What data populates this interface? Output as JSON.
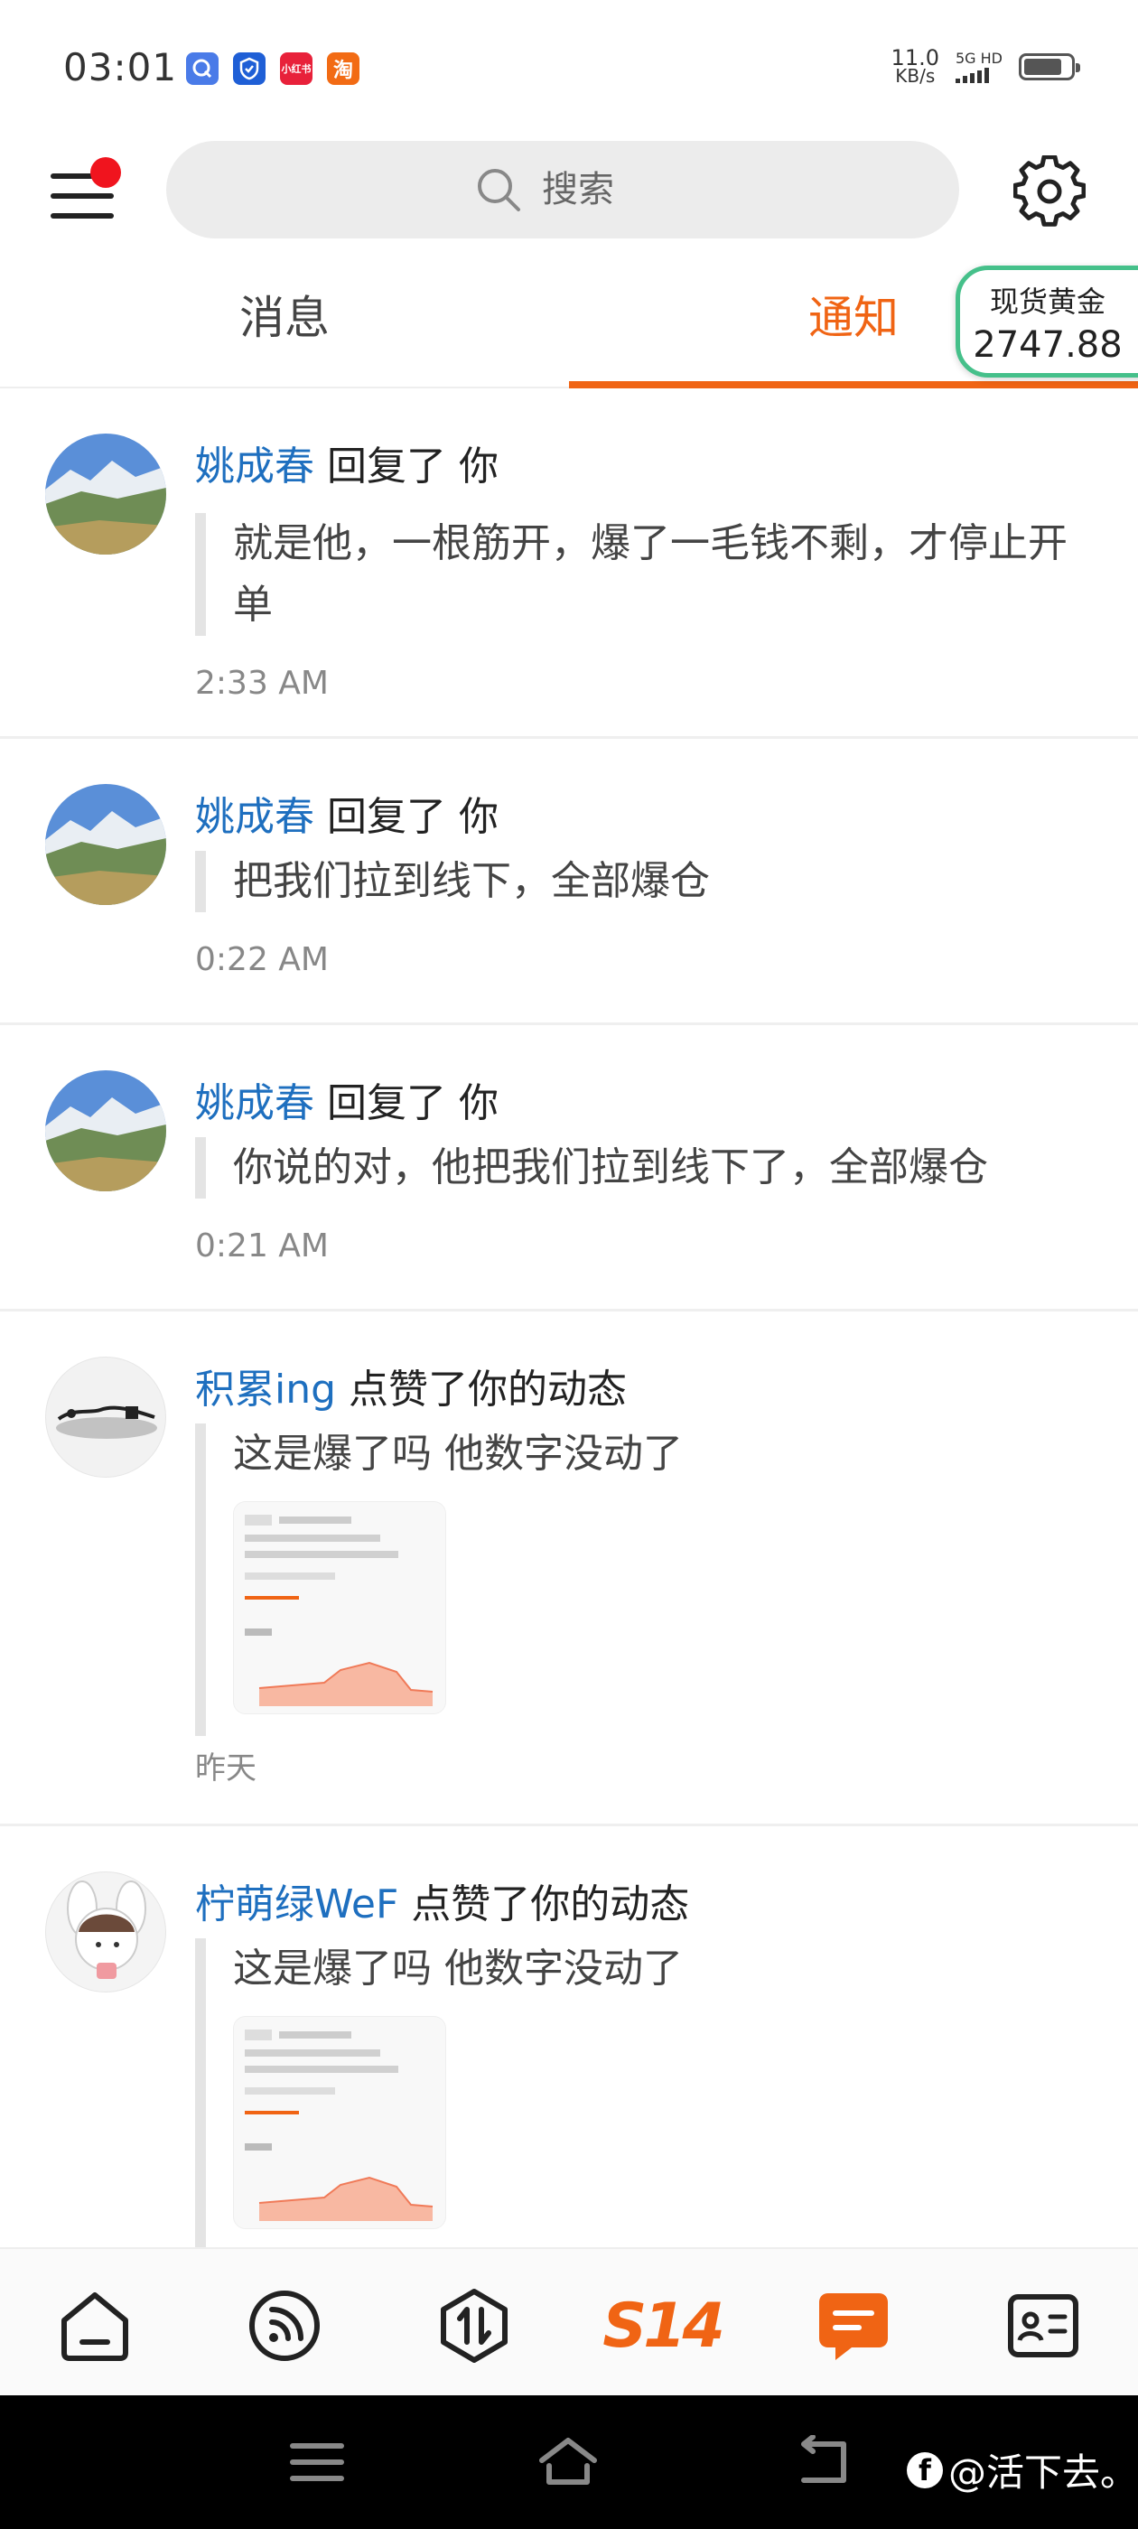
{
  "status_bar": {
    "time": "03:01",
    "apps": [
      {
        "icon": "app-icon-blue-q",
        "color": "#4a7be8",
        "label": "Q"
      },
      {
        "icon": "app-icon-shield",
        "color": "#1f5fd6",
        "label": "盾"
      },
      {
        "icon": "app-icon-xiaohongshu",
        "color": "#e8213a",
        "label": "小红书"
      },
      {
        "icon": "app-icon-taobao",
        "color": "#f26b14",
        "label": "淘"
      }
    ],
    "net_speed_value": "11.0",
    "net_speed_unit": "KB/s",
    "network": "5G HD",
    "battery_level": 0.82
  },
  "top_bar": {
    "search_placeholder": "搜索"
  },
  "tabs": {
    "messages": "消息",
    "notice": "通知",
    "active": "notice"
  },
  "gold_badge": {
    "label": "现货黄金",
    "value": "2747.88"
  },
  "notifications": [
    {
      "user": "姚成春",
      "action": "回复了 你",
      "content": "就是他，一根筋开，爆了一毛钱不剩，才停止开单",
      "time": "2:33 AM"
    },
    {
      "user": "姚成春",
      "action": "回复了 你",
      "content": "把我们拉到线下，全部爆仓",
      "time": "0:22 AM"
    },
    {
      "user": "姚成春",
      "action": "回复了 你",
      "content": "你说的对，他把我们拉到线下了，全部爆仓",
      "time": "0:21 AM"
    },
    {
      "user": "积累ing",
      "action": "点赞了你的动态",
      "content": "这是爆了吗 他数字没动了",
      "time": "昨天"
    },
    {
      "user": "柠萌绿WeF",
      "action": "点赞了你的动态",
      "content": "这是爆了吗 他数字没动了",
      "time": ""
    }
  ],
  "bottom_nav": {
    "s14_label": "S14"
  },
  "watermark": {
    "logo": "f",
    "text": "@活下去。"
  },
  "colors": {
    "accent": "#f06414",
    "link": "#1e6fbf",
    "gold_border": "#45c08a"
  }
}
